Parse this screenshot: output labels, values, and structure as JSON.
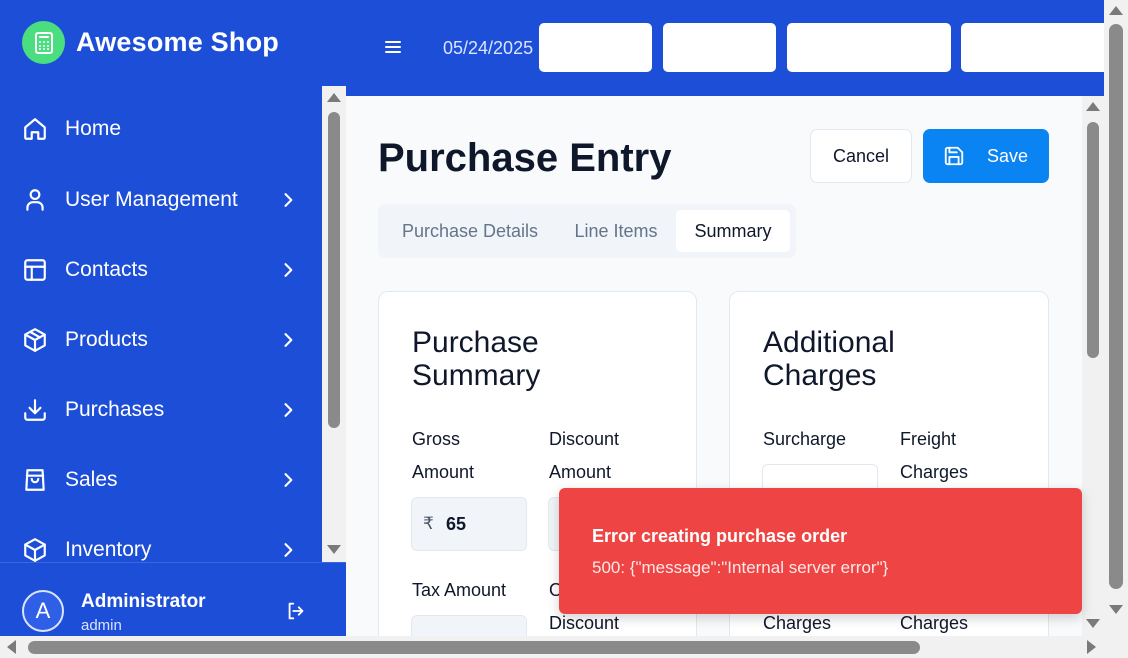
{
  "app": {
    "name": "Awesome Shop",
    "logo_icon": "calculator-icon",
    "brand_color": "#4ade80"
  },
  "sidebar": {
    "background": "#1d4ed8",
    "items": [
      {
        "label": "Home",
        "icon": "home-icon",
        "has_submenu": false
      },
      {
        "label": "User Management",
        "icon": "user-icon",
        "has_submenu": true
      },
      {
        "label": "Contacts",
        "icon": "layout-icon",
        "has_submenu": true
      },
      {
        "label": "Products",
        "icon": "package-icon",
        "has_submenu": true
      },
      {
        "label": "Purchases",
        "icon": "download-icon",
        "has_submenu": true
      },
      {
        "label": "Sales",
        "icon": "shopping-bag-icon",
        "has_submenu": true
      },
      {
        "label": "Inventory",
        "icon": "box-icon",
        "has_submenu": true
      }
    ],
    "user": {
      "avatar_letter": "A",
      "name": "Administrator",
      "role": "admin"
    }
  },
  "header": {
    "date": "05/24/2025"
  },
  "page": {
    "title": "Purchase Entry",
    "cancel_label": "Cancel",
    "save_label": "Save",
    "tabs": [
      {
        "label": "Purchase Details",
        "active": false
      },
      {
        "label": "Line Items",
        "active": false
      },
      {
        "label": "Summary",
        "active": true
      }
    ]
  },
  "summary_card": {
    "title_line1": "Purchase",
    "title_line2": "Summary",
    "gross_label_1": "Gross",
    "gross_label_2": "Amount",
    "gross_currency": "₹",
    "gross_value": "65",
    "discount_label_1": "Discount",
    "discount_label_2": "Amount",
    "tax_label": "Tax Amount",
    "other_discount_label_1": "O",
    "other_discount_label_2": "Discount"
  },
  "charges_card": {
    "title_line1": "Additional",
    "title_line2": "Charges",
    "surcharge_label": "Surcharge",
    "freight_label_1": "Freight",
    "freight_label_2": "Charges",
    "bottom_left_label": "Charges",
    "bottom_right_label": "Charges"
  },
  "toast": {
    "title": "Error creating purchase order",
    "message": "500: {\"message\":\"Internal server error\"}",
    "color": "#ef4444"
  }
}
